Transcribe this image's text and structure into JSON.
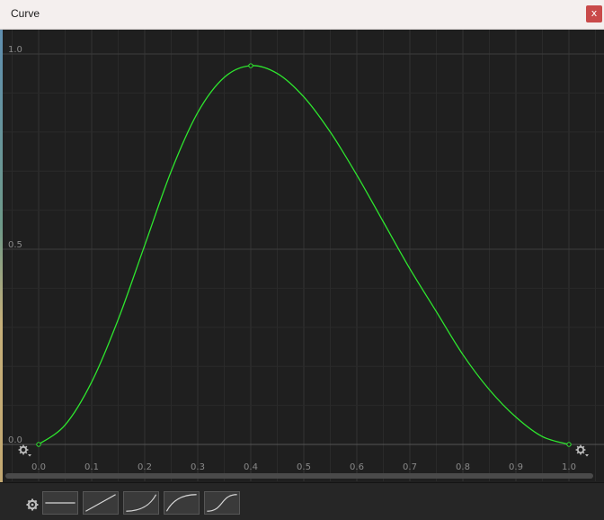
{
  "window": {
    "title": "Curve",
    "close_label": "x"
  },
  "colors": {
    "curve": "#2ee62e",
    "background": "#1f1f1f",
    "grid_major": "#3a3a3a",
    "grid_minor": "#2a2a2a",
    "axis_text": "#8a8a8a",
    "titlebar": "#f4efee",
    "close_button": "#c94a4a"
  },
  "chart_data": {
    "type": "line",
    "title": "",
    "xlabel": "",
    "ylabel": "",
    "xlim": [
      0.0,
      1.0
    ],
    "ylim": [
      0.0,
      1.0
    ],
    "x_ticks": [
      "0.0",
      "0.1",
      "0.2",
      "0.3",
      "0.4",
      "0.5",
      "0.6",
      "0.7",
      "0.8",
      "0.9",
      "1.0"
    ],
    "y_ticks": [
      "0.0",
      "0.5",
      "1.0"
    ],
    "grid": true,
    "keyframes": [
      {
        "x": 0.0,
        "y": 0.0
      },
      {
        "x": 0.4,
        "y": 0.97
      },
      {
        "x": 1.0,
        "y": 0.0
      }
    ],
    "series": [
      {
        "x": [
          0.0,
          0.05,
          0.1,
          0.15,
          0.2,
          0.25,
          0.3,
          0.35,
          0.4,
          0.45,
          0.5,
          0.55,
          0.6,
          0.65,
          0.7,
          0.75,
          0.8,
          0.85,
          0.9,
          0.95,
          1.0
        ],
        "values": [
          0.0,
          0.05,
          0.16,
          0.32,
          0.51,
          0.7,
          0.85,
          0.94,
          0.97,
          0.95,
          0.89,
          0.8,
          0.69,
          0.57,
          0.45,
          0.34,
          0.23,
          0.14,
          0.07,
          0.02,
          0.0
        ]
      }
    ]
  },
  "presets": [
    {
      "name": "constant"
    },
    {
      "name": "linear"
    },
    {
      "name": "ease-in"
    },
    {
      "name": "ease-out"
    },
    {
      "name": "ease-in-out"
    }
  ],
  "icons": {
    "left_key_gear": "gear-icon",
    "right_key_gear": "gear-icon",
    "presets_gear": "gear-icon"
  }
}
